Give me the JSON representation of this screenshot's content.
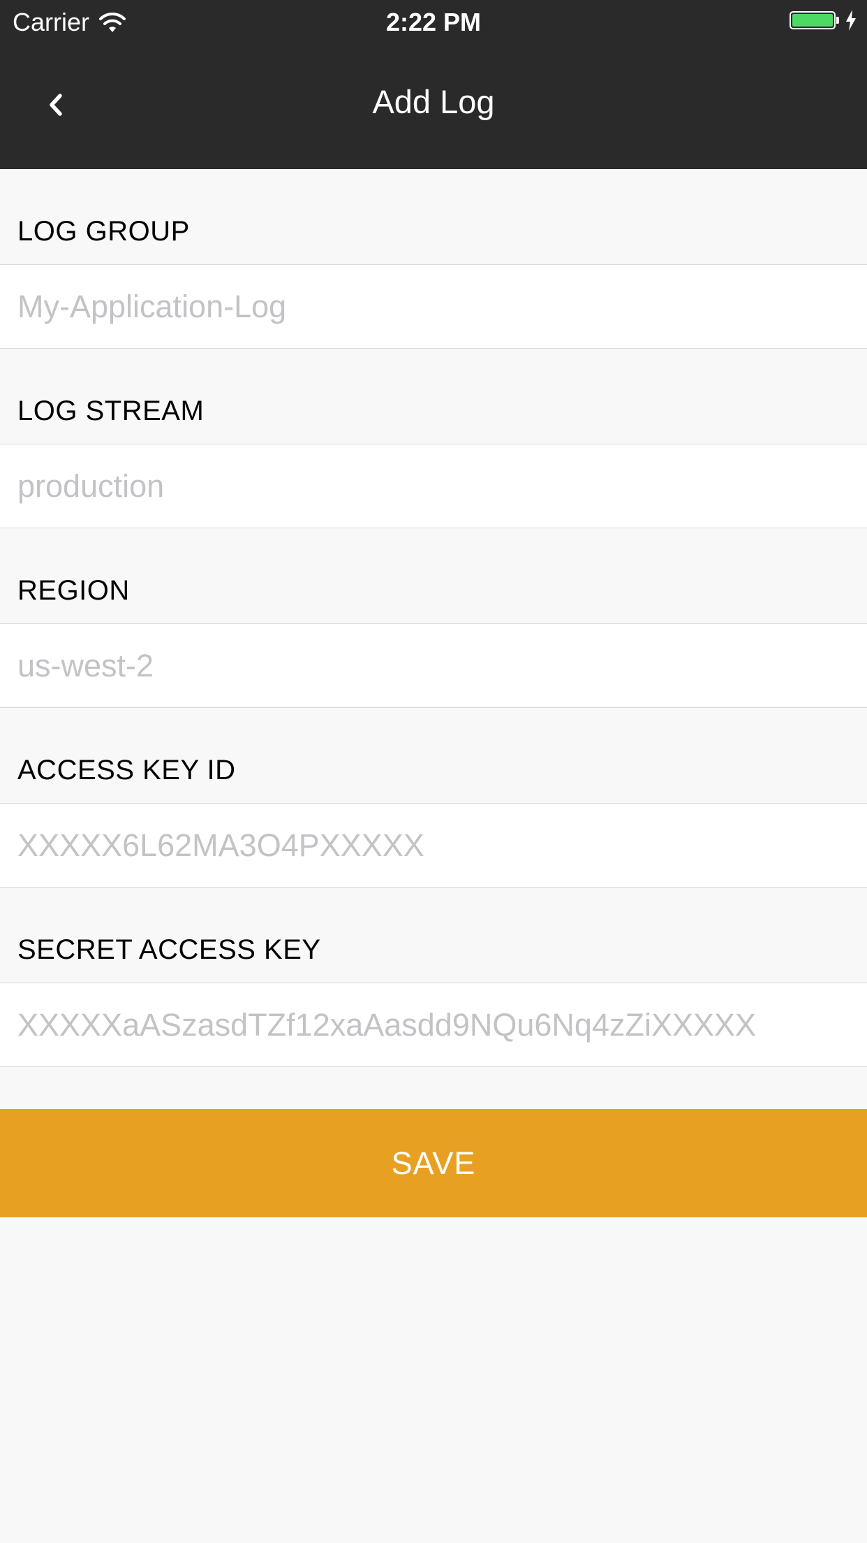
{
  "status_bar": {
    "carrier": "Carrier",
    "time": "2:22 PM",
    "battery_color": "#4cd964"
  },
  "nav": {
    "back_icon": "chevron-left-icon",
    "title": "Add Log"
  },
  "form": {
    "fields": [
      {
        "label": "LOG GROUP",
        "placeholder": "My-Application-Log",
        "value": ""
      },
      {
        "label": "LOG STREAM",
        "placeholder": "production",
        "value": ""
      },
      {
        "label": "REGION",
        "placeholder": "us-west-2",
        "value": ""
      },
      {
        "label": "ACCESS KEY ID",
        "placeholder": "XXXXX6L62MA3O4PXXXXX",
        "value": ""
      },
      {
        "label": "SECRET ACCESS KEY",
        "placeholder": "XXXXXaASzasdTZf12xaAasdd9NQu6Nq4zZiXXXXX",
        "value": ""
      }
    ]
  },
  "save_button": {
    "label": "SAVE",
    "color": "#e8a023"
  },
  "colors": {
    "header_bg": "#2a2a2a",
    "page_bg": "#f8f8f8",
    "placeholder": "#c3c3c7"
  }
}
